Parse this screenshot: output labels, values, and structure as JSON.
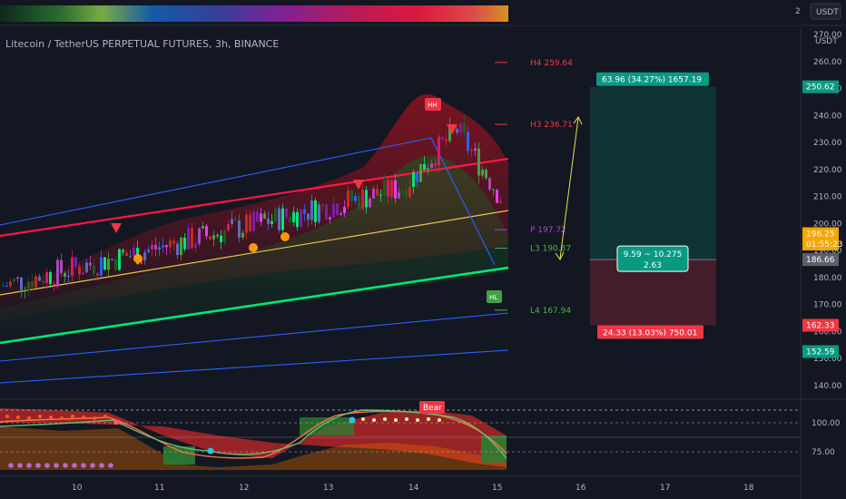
{
  "title": "Litecoin / TetherUS PERPETUAL FUTURES, 3h, BINANCE",
  "currency": "USDT",
  "top_strip": {
    "tick": "2",
    "currency": "USDT"
  },
  "colors": {
    "bg": "#131722",
    "up": "#26a69a",
    "down": "#ef5350",
    "green_line": "#00e676",
    "red_line": "#ff1744",
    "blue_line": "#2962ff",
    "yellow_line": "#e6c84a"
  },
  "chart_data": [
    {
      "type": "candlestick",
      "x_ticks": [
        "10",
        "11",
        "12",
        "13",
        "14",
        "15",
        "16",
        "17",
        "18"
      ],
      "y_ticks": [
        270,
        260,
        250,
        240,
        230,
        220,
        210,
        200,
        190,
        180,
        170,
        160,
        150,
        140
      ],
      "ylim": [
        135,
        275
      ],
      "price_tags": [
        {
          "label": "250.62",
          "color": "#089981"
        },
        {
          "label": "196.25",
          "color": "#f7a600"
        },
        {
          "label": "01:55:23",
          "color": "#f7a600"
        },
        {
          "label": "186.66",
          "color": "#5d606b"
        },
        {
          "label": "162.33",
          "color": "#f23645"
        },
        {
          "label": "152.59",
          "color": "#089981"
        }
      ],
      "pivots": [
        {
          "label": "H4 259.64",
          "value": 259.64,
          "color": "#f23645"
        },
        {
          "label": "H3 236.71",
          "value": 236.71,
          "color": "#f23645"
        },
        {
          "label": "P 197.72",
          "value": 197.72,
          "color": "#ab47bc"
        },
        {
          "label": "L3 190.87",
          "value": 190.87,
          "color": "#4caf50"
        },
        {
          "label": "L4 167.94",
          "value": 167.94,
          "color": "#4caf50"
        }
      ],
      "position": {
        "entry": 186.66,
        "target": 250.62,
        "stop": 162.33,
        "target_label": "63.96 (34.27%) 1657.19",
        "stop_label": "24.33 (13.03%) 750.01",
        "ratio_line1": "9.59 ~ 10.275",
        "ratio_line2": "2.63"
      },
      "markers": [
        "HH",
        "HL"
      ]
    },
    {
      "type": "line",
      "name": "",
      "y_ticks": [
        100.0,
        75.0
      ],
      "badge": "Bear"
    }
  ]
}
